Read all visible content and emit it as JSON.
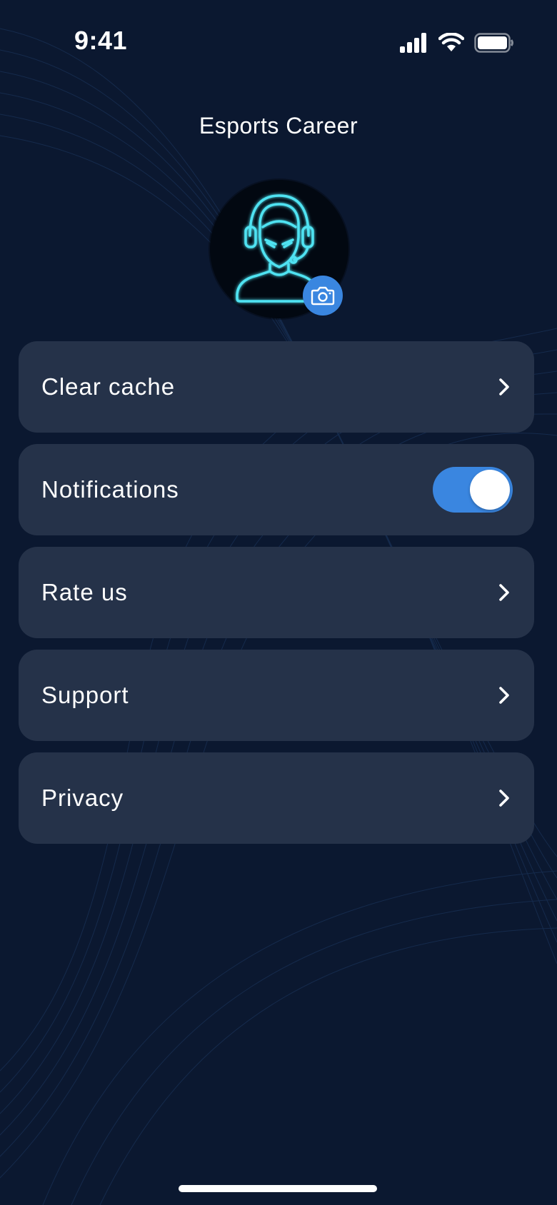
{
  "status_bar": {
    "time": "9:41",
    "icons": [
      "cellular-signal-icon",
      "wifi-icon",
      "battery-icon"
    ]
  },
  "header": {
    "title": "Esports Career"
  },
  "profile": {
    "avatar_icon": "gamer-headset-avatar-icon",
    "camera_icon": "camera-icon",
    "accent_color": "#4fe3f2"
  },
  "settings": {
    "items": [
      {
        "label": "Clear cache",
        "control": "chevron-right-icon"
      },
      {
        "label": "Notifications",
        "control": "toggle",
        "enabled": true
      },
      {
        "label": "Rate us",
        "control": "chevron-right-icon"
      },
      {
        "label": "Support",
        "control": "chevron-right-icon"
      },
      {
        "label": "Privacy",
        "control": "chevron-right-icon"
      }
    ]
  },
  "colors": {
    "background": "#0b1830",
    "row_background": "#253249",
    "accent_blue": "#3a86e0"
  }
}
